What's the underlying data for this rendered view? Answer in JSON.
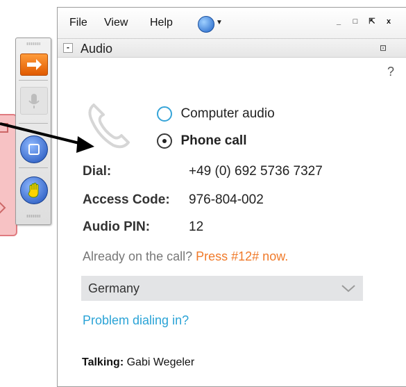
{
  "menu": {
    "file": "File",
    "view": "View",
    "help": "Help",
    "language_icon": "globe-icon"
  },
  "window_controls": {
    "minimize": "_",
    "maximize": "□",
    "popout": "⇱",
    "close": "x"
  },
  "audio_section": {
    "title": "Audio",
    "collapse": "-",
    "help": "?"
  },
  "audio_options": {
    "computer": "Computer audio",
    "phone": "Phone call",
    "selected": "phone"
  },
  "dial_info": {
    "dial_label": "Dial:",
    "dial_value": "+49 (0) 692 5736 7327",
    "access_label": "Access Code:",
    "access_value": "976-804-002",
    "pin_label": "Audio PIN:",
    "pin_value": "12"
  },
  "already_on_call": {
    "text": "Already on the call?",
    "action": "Press #12# now."
  },
  "country_select": {
    "selected": "Germany"
  },
  "problem_link": "Problem dialing in?",
  "talking": {
    "label": "Talking:",
    "name": "Gabi Wegeler"
  },
  "colors": {
    "accent_orange": "#f07a2a",
    "link_blue": "#2aa3d6",
    "radio_blue": "#36a4d8"
  }
}
